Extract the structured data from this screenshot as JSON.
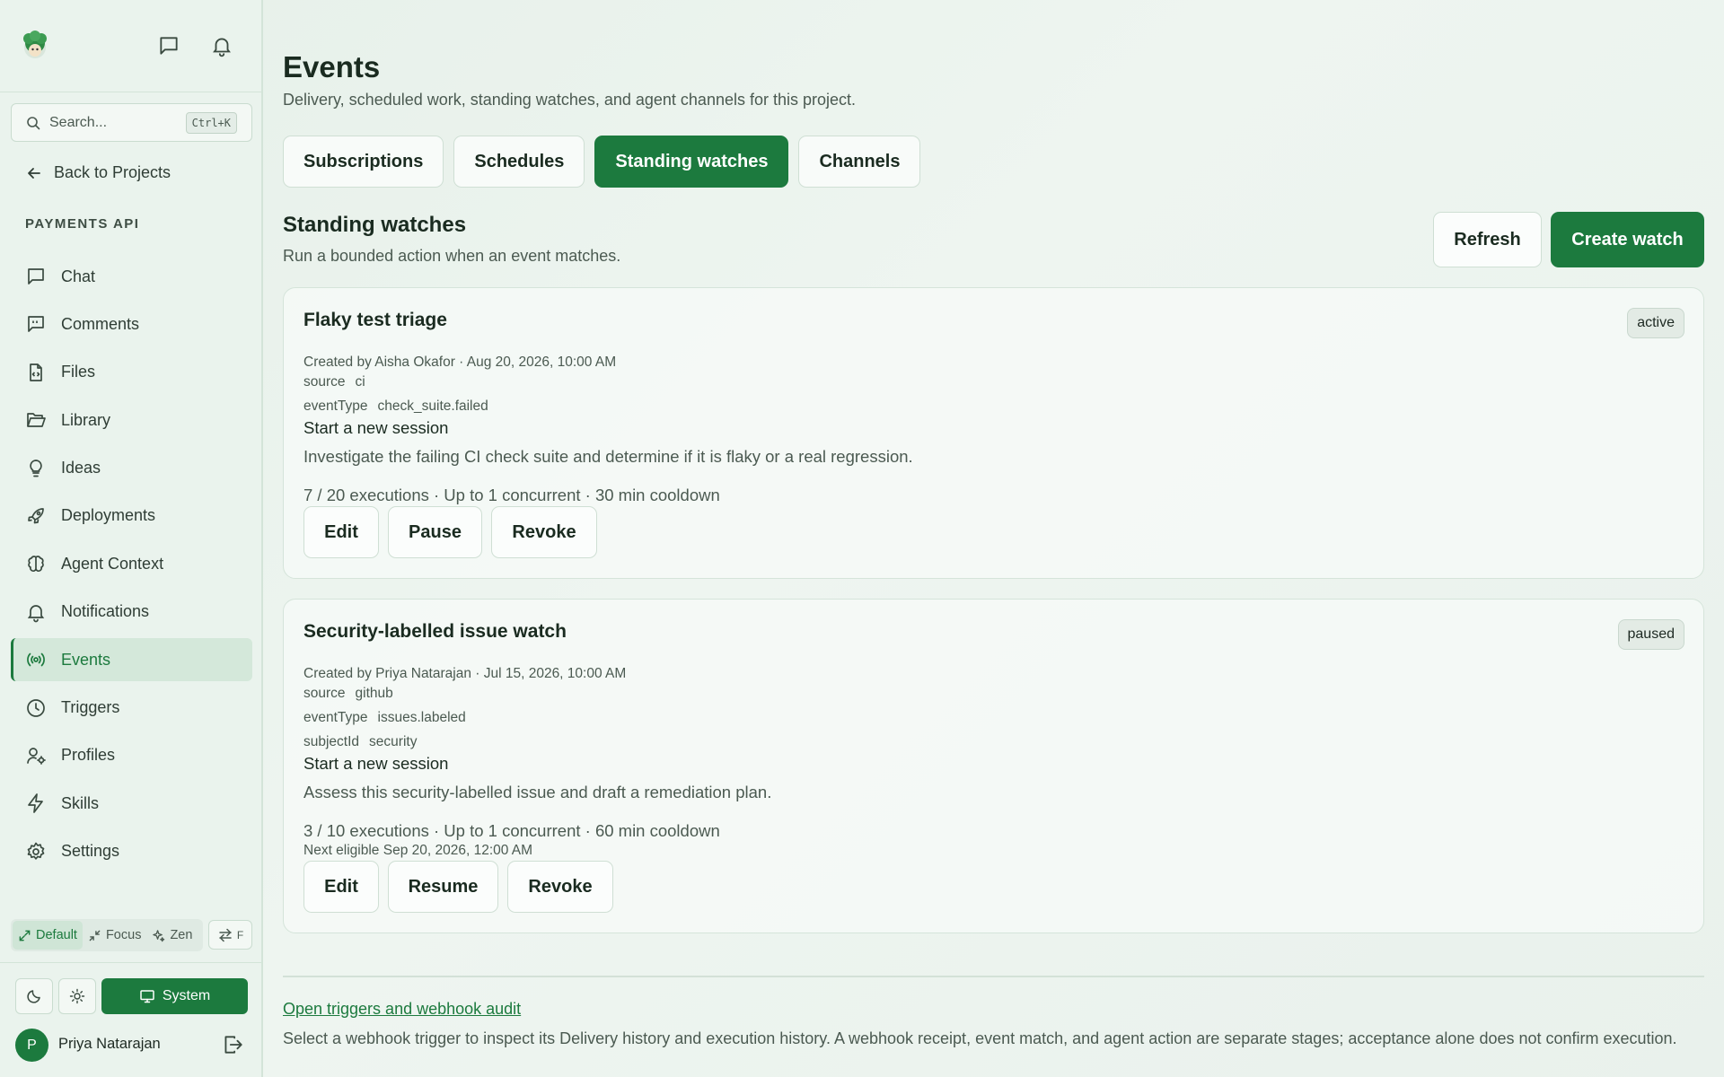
{
  "sidebar": {
    "search": {
      "placeholder": "Search...",
      "shortcut": "Ctrl+K"
    },
    "back_label": "Back to Projects",
    "project_name": "PAYMENTS API",
    "items": [
      {
        "label": "Chat",
        "icon": "chat-icon"
      },
      {
        "label": "Comments",
        "icon": "comments-icon"
      },
      {
        "label": "Files",
        "icon": "file-code-icon"
      },
      {
        "label": "Library",
        "icon": "folder-open-icon"
      },
      {
        "label": "Ideas",
        "icon": "lightbulb-icon"
      },
      {
        "label": "Deployments",
        "icon": "rocket-icon"
      },
      {
        "label": "Agent Context",
        "icon": "brain-icon"
      },
      {
        "label": "Notifications",
        "icon": "bell-icon"
      },
      {
        "label": "Events",
        "icon": "radio-icon",
        "active": true
      },
      {
        "label": "Triggers",
        "icon": "clock-icon"
      },
      {
        "label": "Profiles",
        "icon": "user-cog-icon"
      },
      {
        "label": "Skills",
        "icon": "zap-icon"
      },
      {
        "label": "Settings",
        "icon": "gear-icon"
      }
    ],
    "modes": {
      "default": "Default",
      "focus": "Focus",
      "zen": "Zen",
      "swap": "F",
      "active": "Default"
    },
    "theme": {
      "system_label": "System",
      "active": "System"
    },
    "user": {
      "name": "Priya Natarajan",
      "initial": "P"
    }
  },
  "header": {
    "title": "Events",
    "subtitle": "Delivery, scheduled work, standing watches, and agent channels for this project."
  },
  "tabs": [
    {
      "label": "Subscriptions"
    },
    {
      "label": "Schedules"
    },
    {
      "label": "Standing watches",
      "active": true
    },
    {
      "label": "Channels"
    }
  ],
  "section": {
    "title": "Standing watches",
    "subtitle": "Run a bounded action when an event matches.",
    "refresh_label": "Refresh",
    "create_label": "Create watch"
  },
  "watches": [
    {
      "title": "Flaky test triage",
      "status": "active",
      "created": "Created by Aisha Okafor · Aug 20, 2026, 10:00 AM",
      "filters": [
        {
          "key": "source",
          "value": "ci"
        },
        {
          "key": "eventType",
          "value": "check_suite.failed"
        }
      ],
      "action": "Start a new session",
      "prompt": "Investigate the failing CI check suite and determine if it is flaky or a real regression.",
      "stats": "7 / 20 executions · Up to 1 concurrent · 30 min cooldown",
      "buttons": [
        "Edit",
        "Pause",
        "Revoke"
      ]
    },
    {
      "title": "Security-labelled issue watch",
      "status": "paused",
      "created": "Created by Priya Natarajan · Jul 15, 2026, 10:00 AM",
      "filters": [
        {
          "key": "source",
          "value": "github"
        },
        {
          "key": "eventType",
          "value": "issues.labeled"
        },
        {
          "key": "subjectId",
          "value": "security"
        }
      ],
      "action": "Start a new session",
      "prompt": "Assess this security-labelled issue and draft a remediation plan.",
      "stats": "3 / 10 executions · Up to 1 concurrent · 60 min cooldown",
      "next_eligible": "Next eligible Sep 20, 2026, 12:00 AM",
      "buttons": [
        "Edit",
        "Resume",
        "Revoke"
      ]
    }
  ],
  "footer": {
    "link_label": "Open triggers and webhook audit",
    "text": "Select a webhook trigger to inspect its Delivery history and execution history. A webhook receipt, event match, and agent action are separate stages; acceptance alone does not confirm execution."
  },
  "colors": {
    "accent": "#1c7a3e",
    "background": "#e9f2ec",
    "sidebar": "#eaf3ed"
  }
}
